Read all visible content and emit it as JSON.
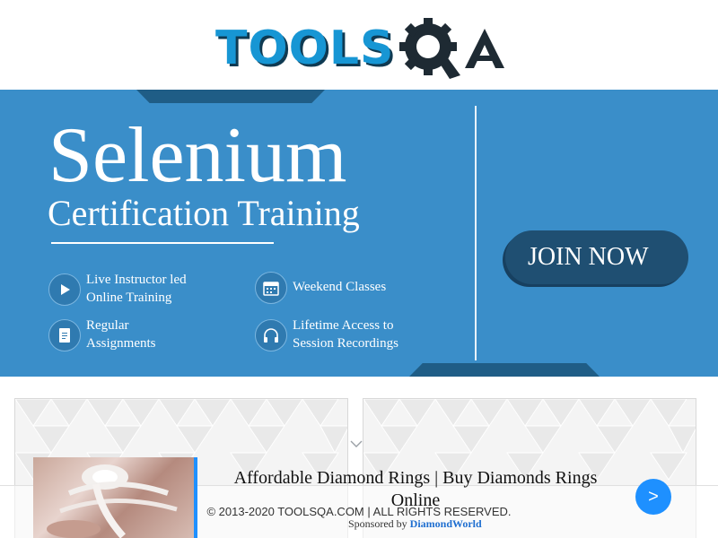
{
  "header": {
    "logo_text": "TOOLS",
    "logo_text_2": "QA"
  },
  "banner": {
    "title": "Selenium",
    "subtitle": "Certification Training",
    "features": [
      {
        "line1": "Live Instructor led",
        "line2": "Online Training",
        "icon": "play-icon"
      },
      {
        "line1": "Regular",
        "line2": "Assignments",
        "icon": "document-icon"
      },
      {
        "line1": "Weekend Classes",
        "line2": "",
        "icon": "calendar-icon"
      },
      {
        "line1": "Lifetime Access to",
        "line2": "Session Recordings",
        "icon": "headphones-icon"
      }
    ],
    "join_label": "JOIN NOW"
  },
  "footer": {
    "copyright": "© 2013-2020 TOOLSQA.COM | ALL RIGHTS RESERVED."
  },
  "ad": {
    "title": "Affordable Diamond Rings | Buy Diamonds Rings Online",
    "sponsor_prefix": "Sponsored by",
    "sponsor_name": "DiamondWorld",
    "next_label": ">"
  },
  "colors": {
    "banner_bg": "#3a8ec9",
    "banner_dark": "#1f5d86",
    "logo_blue": "#1796d4",
    "join_button": "#1f4f72",
    "ad_next": "#1e90ff"
  }
}
